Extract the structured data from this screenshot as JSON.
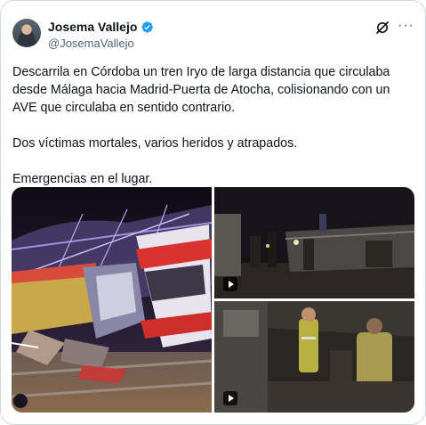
{
  "author": {
    "display_name": "Josema Vallejo",
    "handle": "@JosemaVallejo",
    "verified": true
  },
  "icons": {
    "avatar": "profile-photo",
    "verified": "verified-badge-icon",
    "grok": "grok-icon",
    "more": "more-icon"
  },
  "colors": {
    "verified_blue": "#1d9bf0",
    "text_secondary": "#536471",
    "border": "#cfd9de"
  },
  "tweet": {
    "text": "Descarrila en Córdoba un tren Iryo de larga distancia que circulaba desde Málaga hacia Madrid-Puerta de Atocha, colisionando con un AVE que circulaba en sentido contrario.\n\nDos víctimas mortales, varios heridos y atrapados.\n\nEmergencias en el lugar."
  },
  "media": {
    "count": 3,
    "items": [
      {
        "kind": "photo",
        "subject": "derailed-train-wreck"
      },
      {
        "kind": "video",
        "subject": "night-rescue-scene"
      },
      {
        "kind": "video",
        "subject": "emergency-workers"
      }
    ]
  }
}
